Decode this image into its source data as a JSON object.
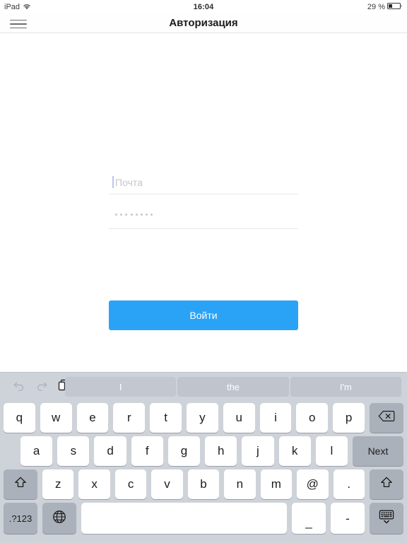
{
  "status_bar": {
    "device": "iPad",
    "wifi_icon": "wifi-icon",
    "time": "16:04",
    "battery_percent": "29 %",
    "battery_icon": "battery-icon"
  },
  "nav_bar": {
    "menu_icon": "hamburger-menu-icon",
    "title": "Авторизация"
  },
  "form": {
    "email": {
      "placeholder": "Почта",
      "value": ""
    },
    "password": {
      "masked_value": "••••••••",
      "dot_count": 8
    },
    "submit_label": "Войти",
    "accent_color": "#2aa3f7"
  },
  "keyboard": {
    "edit_icons": [
      {
        "name": "undo-icon",
        "glyph": "↩",
        "enabled": false
      },
      {
        "name": "redo-icon",
        "glyph": "↪",
        "enabled": false
      },
      {
        "name": "paste-icon",
        "glyph": "❐",
        "enabled": true
      }
    ],
    "suggestions": [
      "I",
      "the",
      "I'm"
    ],
    "row1": [
      "q",
      "w",
      "e",
      "r",
      "t",
      "y",
      "u",
      "i",
      "o",
      "p"
    ],
    "row1_action": "backspace",
    "row2": [
      "a",
      "s",
      "d",
      "f",
      "g",
      "h",
      "j",
      "k",
      "l"
    ],
    "row2_action": "Next",
    "row3": [
      "z",
      "x",
      "c",
      "v",
      "b",
      "n",
      "m",
      "@",
      "."
    ],
    "row3_shift_left": "shift",
    "row3_shift_right": "shift",
    "row4": {
      "numbers_label": ".?123",
      "globe": "globe-icon",
      "space": "",
      "underscore": "_",
      "hyphen": "-",
      "hide_keyboard": "hide-keyboard-icon"
    },
    "background_color": "#ced2d9",
    "key_color": "#ffffff",
    "dark_key_color": "#abb1ba"
  }
}
